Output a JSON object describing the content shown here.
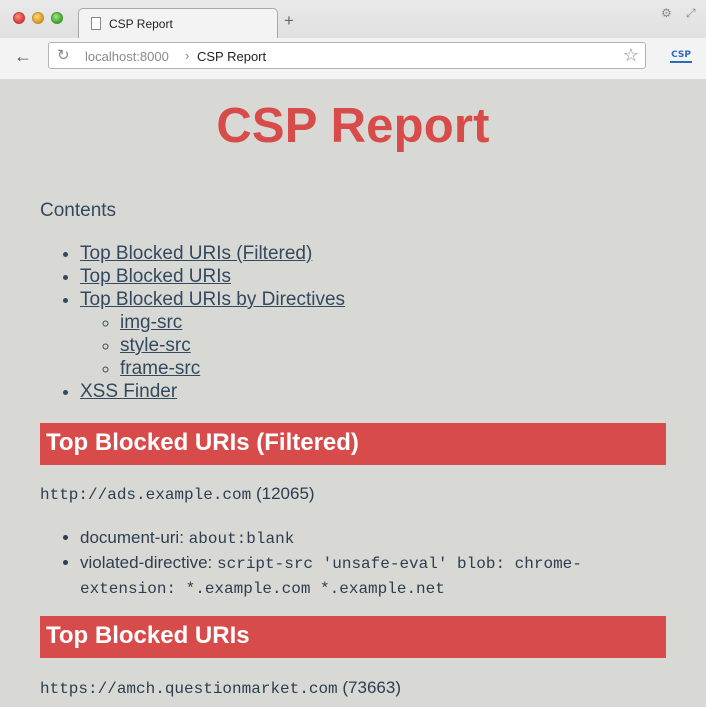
{
  "browser": {
    "tab_title": "CSP Report",
    "new_tab_glyph": "+",
    "url_host": "localhost:8000",
    "url_separator": "›",
    "url_path": "CSP Report",
    "extension_label": "CSP",
    "icons": {
      "back": "←",
      "reload": "↻",
      "star": "☆",
      "gear": "⚙",
      "resize": "⤢"
    }
  },
  "page": {
    "title": "CSP Report",
    "contents_heading": "Contents",
    "toc": [
      "Top Blocked URIs (Filtered)",
      "Top Blocked URIs",
      "Top Blocked URIs by Directives",
      "XSS Finder"
    ],
    "toc_sub": [
      "img-src",
      "style-src",
      "frame-src"
    ],
    "sections": [
      {
        "heading": "Top Blocked URIs (Filtered)",
        "uri": "http://ads.example.com",
        "count": "(12065)",
        "details": [
          {
            "key": "document-uri:",
            "value": "about:blank"
          },
          {
            "key": "violated-directive:",
            "value": "script-src 'unsafe-eval' blob: chrome-extension: *.example.com *.example.net"
          }
        ]
      },
      {
        "heading": "Top Blocked URIs",
        "uri": "https://amch.questionmarket.com",
        "count": "(73663)"
      }
    ]
  },
  "colors": {
    "accent_red": "#d84b4b",
    "text_dark": "#2d3e50",
    "page_bg": "#d8d9d4"
  }
}
